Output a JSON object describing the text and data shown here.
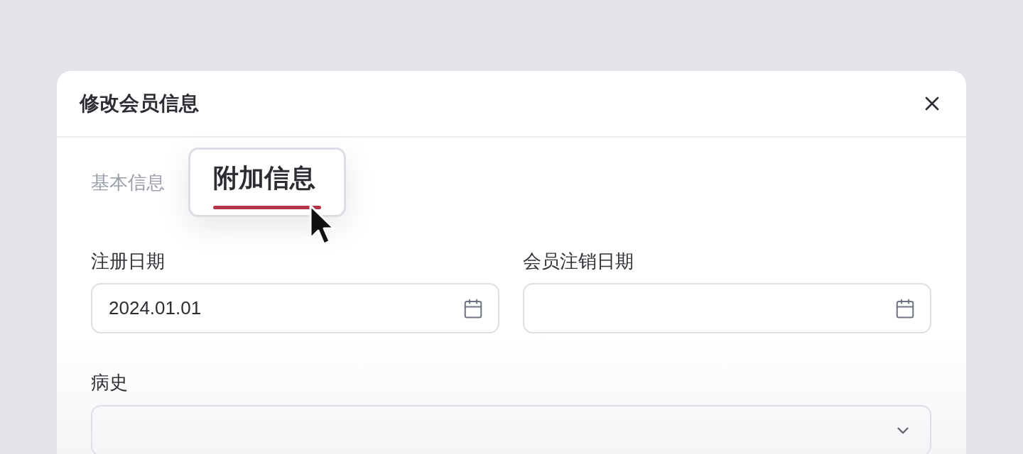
{
  "dialog": {
    "title": "修改会员信息"
  },
  "tabs": [
    {
      "label": "基本信息",
      "selected": false
    },
    {
      "label": "附加信息",
      "selected": true
    }
  ],
  "fields": [
    {
      "kind": "date",
      "label": "注册日期",
      "value": "2024.01.01"
    },
    {
      "kind": "date",
      "label": "会员注销日期"
    },
    {
      "kind": "select",
      "label": "病史"
    }
  ]
}
